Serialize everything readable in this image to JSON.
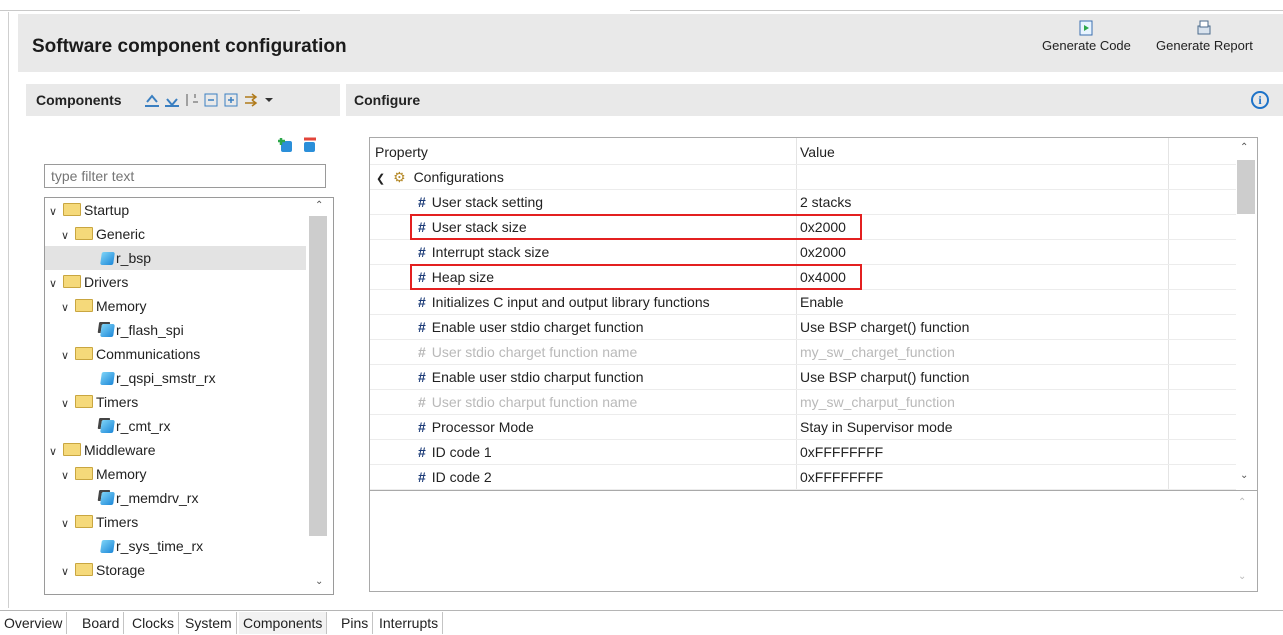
{
  "page": {
    "title": "Software component configuration"
  },
  "actions": {
    "generate_code": "Generate Code",
    "generate_report": "Generate Report"
  },
  "components": {
    "title": "Components",
    "filter_placeholder": "type filter text",
    "tree": [
      {
        "label": "Startup",
        "level": 0,
        "type": "folder"
      },
      {
        "label": "Generic",
        "level": 1,
        "type": "folder"
      },
      {
        "label": "r_bsp",
        "level": 2,
        "type": "component",
        "selected": true
      },
      {
        "label": "Drivers",
        "level": 0,
        "type": "folder"
      },
      {
        "label": "Memory",
        "level": 1,
        "type": "folder"
      },
      {
        "label": "r_flash_spi",
        "level": 2,
        "type": "component-info"
      },
      {
        "label": "Communications",
        "level": 1,
        "type": "folder"
      },
      {
        "label": "r_qspi_smstr_rx",
        "level": 2,
        "type": "component"
      },
      {
        "label": "Timers",
        "level": 1,
        "type": "folder"
      },
      {
        "label": "r_cmt_rx",
        "level": 2,
        "type": "component-info"
      },
      {
        "label": "Middleware",
        "level": 0,
        "type": "folder"
      },
      {
        "label": "Memory",
        "level": 1,
        "type": "folder"
      },
      {
        "label": "r_memdrv_rx",
        "level": 2,
        "type": "component-info"
      },
      {
        "label": "Timers",
        "level": 1,
        "type": "folder"
      },
      {
        "label": "r_sys_time_rx",
        "level": 2,
        "type": "component"
      },
      {
        "label": "Storage",
        "level": 1,
        "type": "folder"
      }
    ]
  },
  "configure": {
    "title": "Configure",
    "columns": {
      "property": "Property",
      "value": "Value"
    },
    "group": "Configurations",
    "rows": [
      {
        "property": "User stack setting",
        "value": "2 stacks",
        "enabled": true
      },
      {
        "property": "User stack size",
        "value": "0x2000",
        "enabled": true,
        "highlighted": true
      },
      {
        "property": "Interrupt stack size",
        "value": "0x2000",
        "enabled": true
      },
      {
        "property": "Heap size",
        "value": "0x4000",
        "enabled": true,
        "highlighted": true
      },
      {
        "property": "Initializes C input and output library functions",
        "value": "Enable",
        "enabled": true
      },
      {
        "property": "Enable user stdio charget function",
        "value": "Use BSP charget() function",
        "enabled": true
      },
      {
        "property": "User stdio charget function name",
        "value": "my_sw_charget_function",
        "enabled": false
      },
      {
        "property": "Enable user stdio charput function",
        "value": "Use BSP charput() function",
        "enabled": true
      },
      {
        "property": "User stdio charput function name",
        "value": "my_sw_charput_function",
        "enabled": false
      },
      {
        "property": "Processor Mode",
        "value": "Stay in Supervisor mode",
        "enabled": true
      },
      {
        "property": "ID code 1",
        "value": "0xFFFFFFFF",
        "enabled": true
      },
      {
        "property": "ID code 2",
        "value": "0xFFFFFFFF",
        "enabled": true
      }
    ]
  },
  "tabs": [
    "Overview",
    "Board",
    "Clocks",
    "System",
    "Components",
    "Pins",
    "Interrupts"
  ],
  "active_tab": "Components",
  "colors": {
    "highlight": "#e32020",
    "header_bg": "#e9e9e9",
    "hash_icon": "#1d3c78"
  }
}
